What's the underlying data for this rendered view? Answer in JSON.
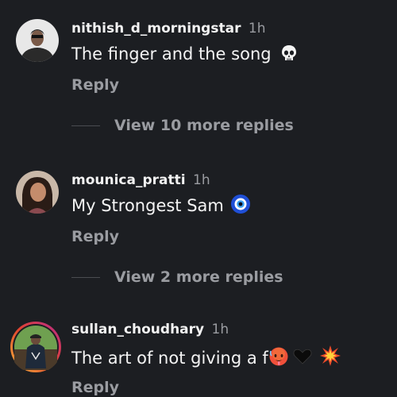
{
  "comments": [
    {
      "username": "nithish_d_morningstar",
      "time": "1h",
      "text": "The finger and the song",
      "reply_label": "Reply",
      "view_more": "View 10 more replies",
      "emoji": [
        "skull-emoji"
      ]
    },
    {
      "username": "mounica_pratti",
      "time": "1h",
      "text": "My Strongest Sam",
      "reply_label": "Reply",
      "view_more": "View 2 more replies",
      "emoji": [
        "nazar-amulet-emoji"
      ]
    },
    {
      "username": "sullan_choudhary",
      "time": "1h",
      "text": "The art of not giving a f",
      "reply_label": "Reply",
      "emoji": [
        "hot-face-emoji",
        "black-heart-emoji",
        "collision-emoji"
      ]
    }
  ],
  "colors": {
    "background": "#1c1e22",
    "secondary_text": "#9a9ca1",
    "story_ring": "#e0a030"
  }
}
